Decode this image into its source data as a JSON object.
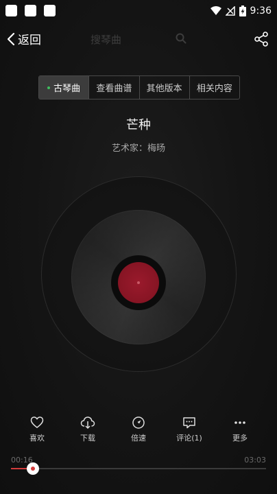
{
  "status_bar": {
    "time": "9:36"
  },
  "header": {
    "back_label": "返回",
    "search_placeholder": "搜琴曲",
    "icons": {
      "back": "chevron-left-icon",
      "search": "search-icon",
      "share": "share-icon"
    }
  },
  "tabs": [
    {
      "label": "古琴曲",
      "active": true
    },
    {
      "label": "查看曲谱",
      "active": false
    },
    {
      "label": "其他版本",
      "active": false
    },
    {
      "label": "相关内容",
      "active": false
    }
  ],
  "song": {
    "title": "芒种",
    "artist": "艺术家：梅旸"
  },
  "actions": [
    {
      "label": "喜欢",
      "icon": "heart-icon"
    },
    {
      "label": "下载",
      "icon": "download-icon"
    },
    {
      "label": "倍速",
      "icon": "speed-icon"
    },
    {
      "label": "评论(1)",
      "icon": "comment-icon"
    },
    {
      "label": "更多",
      "icon": "more-icon"
    }
  ],
  "player": {
    "current_time": "00:16",
    "total_time": "03:03",
    "progress_fraction": 0.087
  },
  "colors": {
    "accent": "#d23b3b",
    "active_dot": "#3fbf5f",
    "record_label": "#8e1627"
  }
}
